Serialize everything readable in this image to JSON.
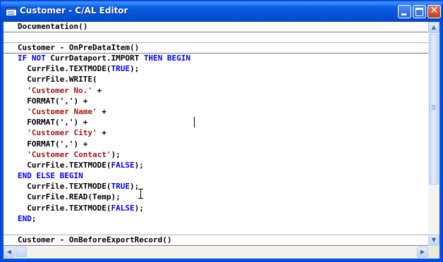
{
  "window": {
    "title": "Customer - C/AL Editor",
    "icon": "editor-window-icon",
    "controls": {
      "minimize": "minimize-icon",
      "maximize": "maximize-icon",
      "close": "close-icon",
      "close_glyph": "✕"
    }
  },
  "editor": {
    "trigger_documentation": "Documentation()",
    "trigger_onpredataitem": "Customer - OnPreDataItem()",
    "trigger_onbeforeexport": "Customer - OnBeforeExportRecord()",
    "code_lines": [
      [
        {
          "t": "IF NOT ",
          "c": "kw"
        },
        {
          "t": "CurrDataport.IMPORT ",
          "c": "plain"
        },
        {
          "t": "THEN BEGIN",
          "c": "kw"
        }
      ],
      [
        {
          "t": "  CurrFile.TEXTMODE(",
          "c": "plain"
        },
        {
          "t": "TRUE",
          "c": "kw"
        },
        {
          "t": ");",
          "c": "plain"
        }
      ],
      [
        {
          "t": "  CurrFile.WRITE(",
          "c": "plain"
        }
      ],
      [
        {
          "t": "  ",
          "c": "plain"
        },
        {
          "t": "'Customer No.'",
          "c": "str"
        },
        {
          "t": " +",
          "c": "plain"
        }
      ],
      [
        {
          "t": "  FORMAT(',') +",
          "c": "plain"
        }
      ],
      [
        {
          "t": "  ",
          "c": "plain"
        },
        {
          "t": "'Customer Name'",
          "c": "str"
        },
        {
          "t": " +",
          "c": "plain"
        }
      ],
      [
        {
          "t": "  FORMAT(',') +",
          "c": "plain"
        }
      ],
      [
        {
          "t": "  ",
          "c": "plain"
        },
        {
          "t": "'Customer City'",
          "c": "str"
        },
        {
          "t": " +",
          "c": "plain"
        }
      ],
      [
        {
          "t": "  FORMAT(',') +",
          "c": "plain"
        }
      ],
      [
        {
          "t": "  ",
          "c": "plain"
        },
        {
          "t": "'Customer Contact'",
          "c": "str"
        },
        {
          "t": ");",
          "c": "plain"
        }
      ],
      [
        {
          "t": "  CurrFile.TEXTMODE(",
          "c": "plain"
        },
        {
          "t": "FALSE",
          "c": "kw"
        },
        {
          "t": ");",
          "c": "plain"
        }
      ],
      [
        {
          "t": "END ELSE BEGIN",
          "c": "kw"
        }
      ],
      [
        {
          "t": "  CurrFile.TEXTMODE(",
          "c": "plain"
        },
        {
          "t": "TRUE",
          "c": "kw"
        },
        {
          "t": ");",
          "c": "plain"
        }
      ],
      [
        {
          "t": "  CurrFile.READ(Temp);",
          "c": "plain"
        }
      ],
      [
        {
          "t": "  CurrFile.TEXTMODE(",
          "c": "plain"
        },
        {
          "t": "FALSE",
          "c": "kw"
        },
        {
          "t": ");",
          "c": "plain"
        }
      ],
      [
        {
          "t": "END",
          "c": "kw"
        },
        {
          "t": ";",
          "c": "plain"
        }
      ]
    ]
  },
  "scrollbars": {
    "up_glyph": "▲",
    "down_glyph": "▼",
    "left_glyph": "◀",
    "right_glyph": "▶"
  },
  "colors": {
    "keyword": "#0000ff",
    "string": "#a31515",
    "titlebar": "#0054e3"
  }
}
